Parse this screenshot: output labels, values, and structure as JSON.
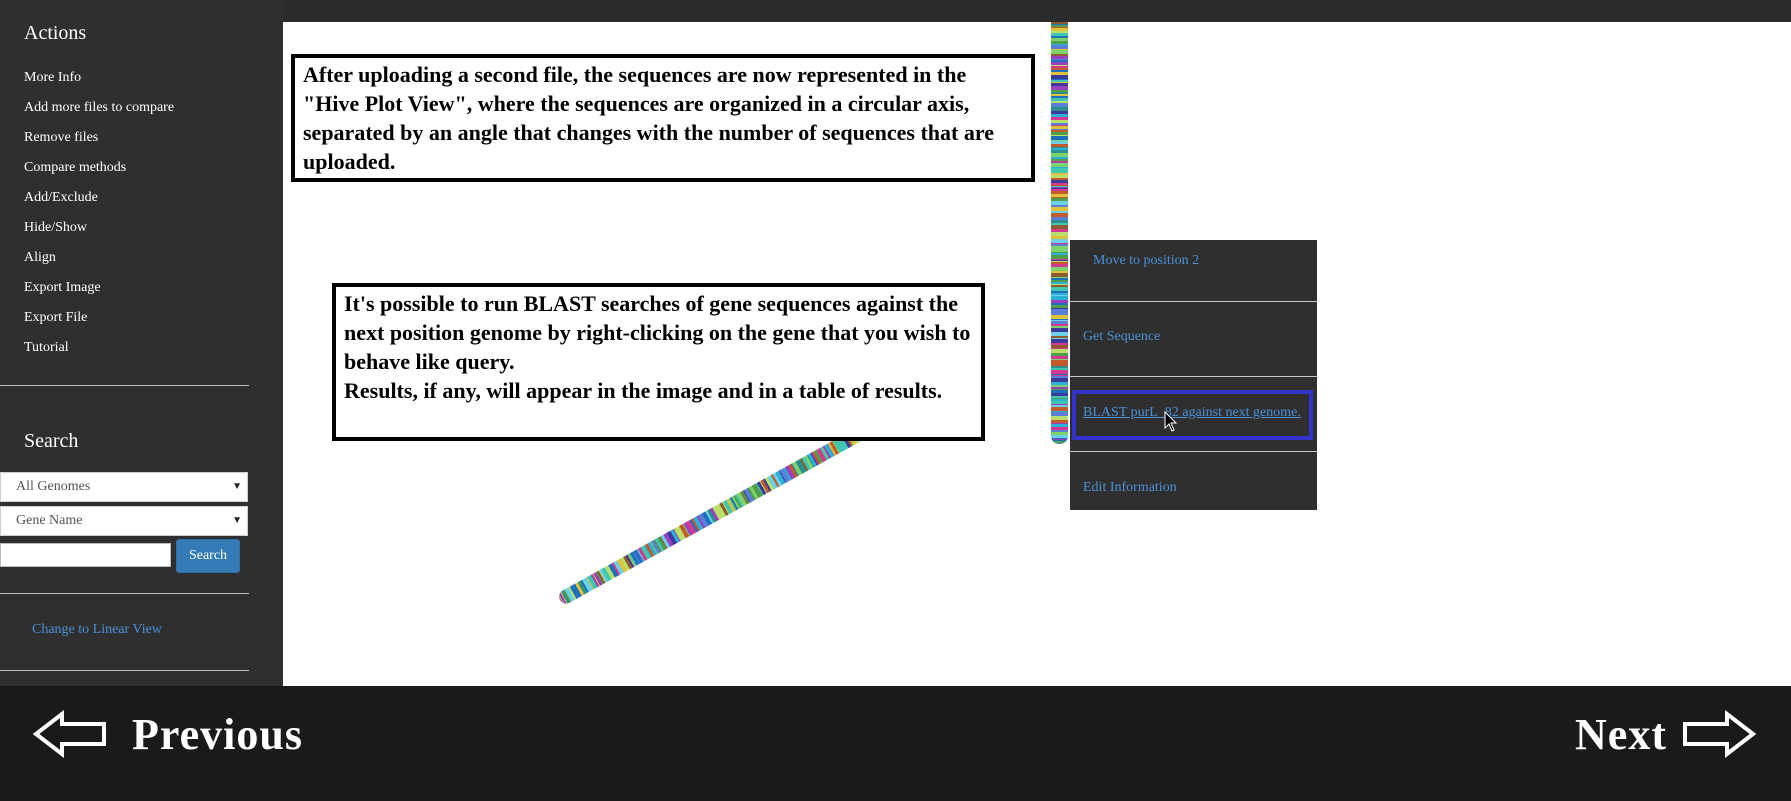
{
  "sidebar": {
    "actions_title": "Actions",
    "actions": [
      {
        "label": "More Info"
      },
      {
        "label": "Add more files to compare"
      },
      {
        "label": "Remove files"
      },
      {
        "label": "Compare methods"
      },
      {
        "label": "Add/Exclude"
      },
      {
        "label": "Hide/Show"
      },
      {
        "label": "Align"
      },
      {
        "label": "Export Image"
      },
      {
        "label": "Export File"
      },
      {
        "label": "Tutorial"
      }
    ],
    "search_title": "Search",
    "genome_select": "All Genomes",
    "field_select": "Gene Name",
    "search_value": "",
    "search_button": "Search",
    "view_link": "Change to Linear View"
  },
  "notes": {
    "hive_plot": "After uploading a second file, the sequences are now represented in the \"Hive Plot View\", where the sequences are organized in a circular axis, separated by an angle that changes with the number of sequences that are uploaded.",
    "blast": "It's possible to run BLAST searches of gene sequences against the next position genome by right-clicking on the gene that you wish to behave like query.",
    "blast_results": "Results, if any, will appear in the image and in a table of results."
  },
  "context_menu": {
    "move": "Move to position 2",
    "get_sequence": "Get Sequence",
    "blast": "BLAST purL_82 against next genome.",
    "edit": "Edit Information"
  },
  "navigation": {
    "previous": "Previous",
    "next": "Next"
  },
  "colors": {
    "sidebar_bg": "#2f2f2f",
    "link": "#4a90d9",
    "highlight_border": "#3333cc",
    "bottom_bar": "#1a1a1a",
    "search_button": "#337ab7"
  },
  "icons": {
    "select_arrow": "triangle-down-icon",
    "previous": "arrow-left-outline-icon",
    "next": "arrow-right-outline-icon",
    "cursor": "mouse-pointer-icon"
  }
}
